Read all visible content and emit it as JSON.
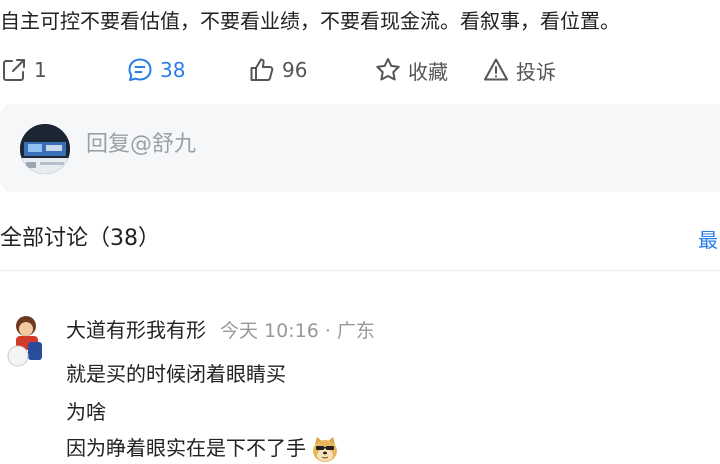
{
  "post": {
    "text": "自主可控不要看估值，不要看业绩，不要看现金流。看叙事，看位置。"
  },
  "actions": {
    "share": {
      "icon": "share-icon",
      "count": "1"
    },
    "comment": {
      "icon": "comment-icon",
      "count": "38"
    },
    "like": {
      "icon": "thumbs-up-icon",
      "count": "96"
    },
    "favorite": {
      "icon": "star-icon",
      "label": "收藏"
    },
    "report": {
      "icon": "warning-icon",
      "label": "投诉"
    }
  },
  "reply": {
    "placeholder": "回复@舒九"
  },
  "discussion": {
    "title": "全部讨论（38）",
    "sort_label": "最"
  },
  "comments": [
    {
      "author": "大道有形我有形",
      "meta": "今天 10:16 · 广东",
      "lines": [
        "就是买的时候闭着眼睛买",
        "为啥",
        "因为睁着眼实在是下不了手"
      ],
      "trailing_emoji": "doge-emoji"
    }
  ],
  "colors": {
    "accent": "#2b7de9",
    "muted": "#999999",
    "reply_bg": "#f6f7f9"
  }
}
